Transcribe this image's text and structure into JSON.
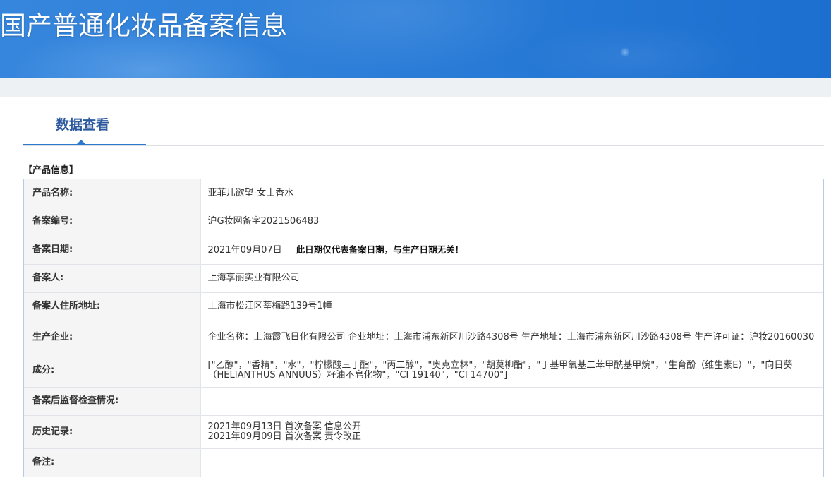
{
  "theme": {
    "header_blue": "#1c6fcf",
    "header_blue_light": "#3686dd",
    "accent": "#2b78cf",
    "tab_text": "#2d5a9e",
    "label_bg": "#f5f5f5",
    "table_border": "#b9cbe3"
  },
  "header": {
    "title": "国产普通化妆品备案信息"
  },
  "tabs": [
    {
      "label": "数据查看",
      "active": true
    }
  ],
  "section": {
    "title": "【产品信息】"
  },
  "info_rows": [
    {
      "label": "产品名称:",
      "value": "亚菲儿欲望-女士香水"
    },
    {
      "label": "备案编号:",
      "value": "沪G妆网备字2021506483"
    },
    {
      "label": "备案日期:",
      "value": "2021年09月07日",
      "note": "此日期仅代表备案日期，与生产日期无关！"
    },
    {
      "label": "备案人:",
      "value": "上海享丽实业有限公司"
    },
    {
      "label": "备案人住所地址:",
      "value": "上海市松江区莘梅路139号1幢"
    },
    {
      "label": "生产企业:",
      "value": "企业名称：上海霞飞日化有限公司 企业地址：上海市浦东新区川沙路4308号 生产地址：上海市浦东新区川沙路4308号 生产许可证：沪妆20160030"
    },
    {
      "label": "成分:",
      "value": "[\"乙醇\"，\"香精\"，\"水\"，\"柠檬酸三丁酯\"，\"丙二醇\"，\"奥克立林\"，\"胡莫柳酯\"，\"丁基甲氧基二苯甲酰基甲烷\"，\"生育酚（维生素E）\"，\"向日葵（HELIANTHUS ANNUUS）籽油不皂化物\"，\"CI 19140\"，\"CI 14700\"]"
    },
    {
      "label": "备案后监督检查情况:",
      "value": ""
    },
    {
      "label": "历史记录:",
      "lines": [
        "2021年09月13日 首次备案 信息公开",
        "2021年09月09日 首次备案 责令改正"
      ]
    },
    {
      "label": "备注:",
      "value": ""
    }
  ]
}
